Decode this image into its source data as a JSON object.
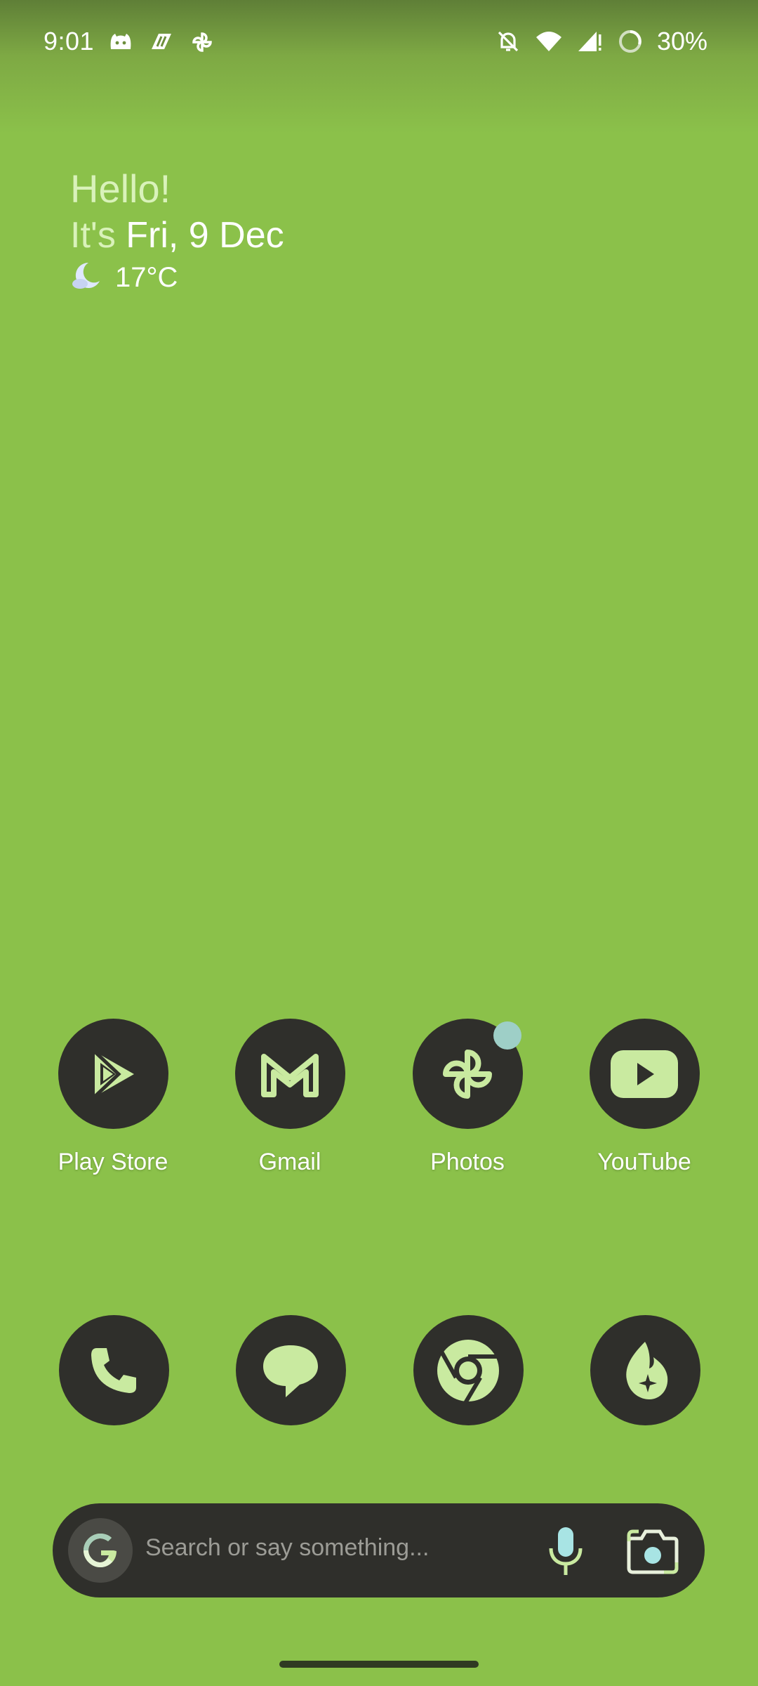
{
  "status_bar": {
    "time": "9:01",
    "left_icons": [
      "assistant-face-icon",
      "stripes-icon",
      "pinwheel-icon"
    ],
    "right_icons": [
      "bell-off-icon",
      "wifi-icon",
      "cell-signal-icon",
      "battery-ring-icon"
    ],
    "battery": "30%"
  },
  "greeting": {
    "hello": "Hello!",
    "date_prefix": "It's",
    "date": "Fri, 9 Dec",
    "temperature": "17°C",
    "weather_icon": "moon-cloud-icon"
  },
  "apps_row": [
    {
      "label": "Play Store",
      "icon": "play-store-icon"
    },
    {
      "label": "Gmail",
      "icon": "gmail-icon"
    },
    {
      "label": "Photos",
      "icon": "photos-icon",
      "notification_dot": true
    },
    {
      "label": "YouTube",
      "icon": "youtube-icon"
    }
  ],
  "dock": [
    {
      "icon": "phone-icon"
    },
    {
      "icon": "messages-icon"
    },
    {
      "icon": "chrome-icon"
    },
    {
      "icon": "ai-spark-icon"
    }
  ],
  "search": {
    "placeholder": "Search or say something..."
  },
  "colors": {
    "wallpaper": "#8bc14a",
    "icon_background": "#2f2f2b",
    "icon_foreground": "#c9eaa0",
    "label_text": "#ffffff"
  }
}
